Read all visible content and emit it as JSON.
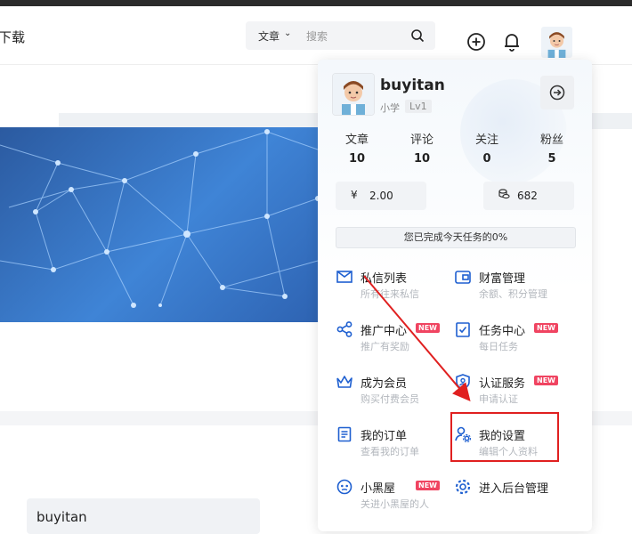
{
  "header": {
    "nav_partial": "下载",
    "search": {
      "category": "文章",
      "placeholder": "搜索"
    }
  },
  "bottom_card": {
    "text": "buyitan"
  },
  "user_menu": {
    "username": "buyitan",
    "level_name": "小学",
    "level_badge": "Lv1",
    "stats": [
      {
        "label": "文章",
        "value": "10"
      },
      {
        "label": "评论",
        "value": "10"
      },
      {
        "label": "关注",
        "value": "0"
      },
      {
        "label": "粉丝",
        "value": "5"
      }
    ],
    "money": {
      "symbol": "¥",
      "value": "2.00"
    },
    "credit": {
      "value": "682"
    },
    "task_progress": "您已完成今天任务的0%",
    "items": [
      {
        "title": "私信列表",
        "subtitle": "所有往来私信",
        "icon": "mail-icon",
        "new": ""
      },
      {
        "title": "财富管理",
        "subtitle": "余额、积分管理",
        "icon": "wallet-icon",
        "new": ""
      },
      {
        "title": "推广中心",
        "subtitle": "推广有奖励",
        "icon": "share-icon",
        "new": "NEW"
      },
      {
        "title": "任务中心",
        "subtitle": "每日任务",
        "icon": "task-icon",
        "new": "NEW"
      },
      {
        "title": "成为会员",
        "subtitle": "购买付费会员",
        "icon": "crown-icon",
        "new": ""
      },
      {
        "title": "认证服务",
        "subtitle": "申请认证",
        "icon": "verify-icon",
        "new": "NEW"
      },
      {
        "title": "我的订单",
        "subtitle": "查看我的订单",
        "icon": "order-icon",
        "new": ""
      },
      {
        "title": "我的设置",
        "subtitle": "编辑个人资料",
        "icon": "user-settings-icon",
        "new": ""
      },
      {
        "title": "小黑屋",
        "subtitle": "关进小黑屋的人",
        "icon": "blackroom-icon",
        "new": "NEW"
      },
      {
        "title": "进入后台管理",
        "subtitle": "",
        "icon": "gear-icon",
        "new": ""
      }
    ]
  },
  "colors": {
    "accent": "#1e5fd0",
    "new_badge": "#f04461",
    "annotation": "#e02020"
  }
}
